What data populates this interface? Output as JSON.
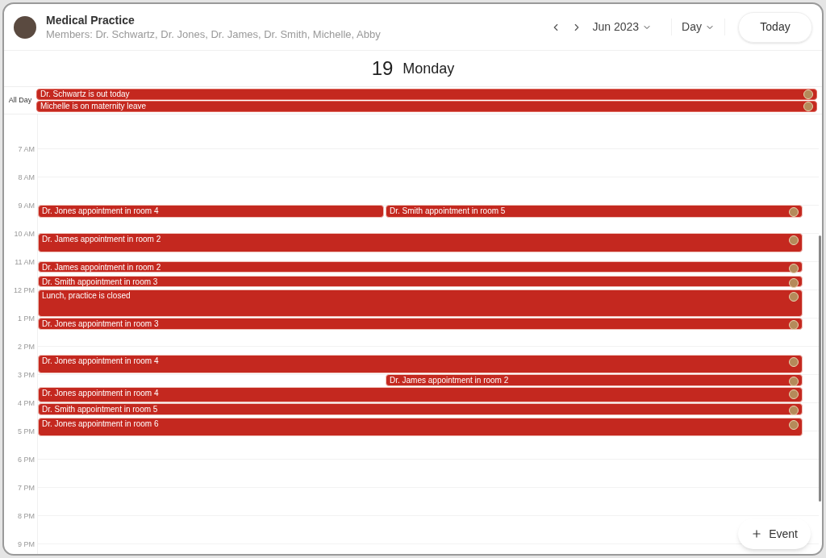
{
  "header": {
    "title": "Medical Practice",
    "members": "Members: Dr. Schwartz, Dr. Jones, Dr. James, Dr. Smith, Michelle, Abby"
  },
  "nav": {
    "month": "Jun 2023",
    "view": "Day",
    "today": "Today"
  },
  "day": {
    "number": "19",
    "weekday": "Monday"
  },
  "all_day": {
    "label": "All Day",
    "events": [
      {
        "title": "Dr. Schwartz is out today"
      },
      {
        "title": "Michelle is on maternity leave"
      }
    ]
  },
  "hours": [
    "7 AM",
    "8 AM",
    "9 AM",
    "10 AM",
    "11 AM",
    "12 PM",
    "1 PM",
    "2 PM",
    "3 PM",
    "4 PM",
    "5 PM",
    "6 PM",
    "7 PM",
    "8 PM",
    "9 PM"
  ],
  "events": [
    {
      "title": "Dr. Jones appointment in room 4"
    },
    {
      "title": "Dr. Smith appointment in room 5"
    },
    {
      "title": "Dr. James appointment in room 2"
    },
    {
      "title": "Dr. James appointment in room 2"
    },
    {
      "title": "Dr. Smith appointment in room 3"
    },
    {
      "title": "Lunch, practice is closed"
    },
    {
      "title": "Dr. Jones appointment in room 3"
    },
    {
      "title": "Dr. Jones appointment in room 4"
    },
    {
      "title": "Dr. James appointment in room 2"
    },
    {
      "title": "Dr. Jones appointment in room 4"
    },
    {
      "title": "Dr. Smith appointment in room 5"
    },
    {
      "title": "Dr. Jones appointment in room 6"
    }
  ],
  "add_button": {
    "label": "Event"
  }
}
